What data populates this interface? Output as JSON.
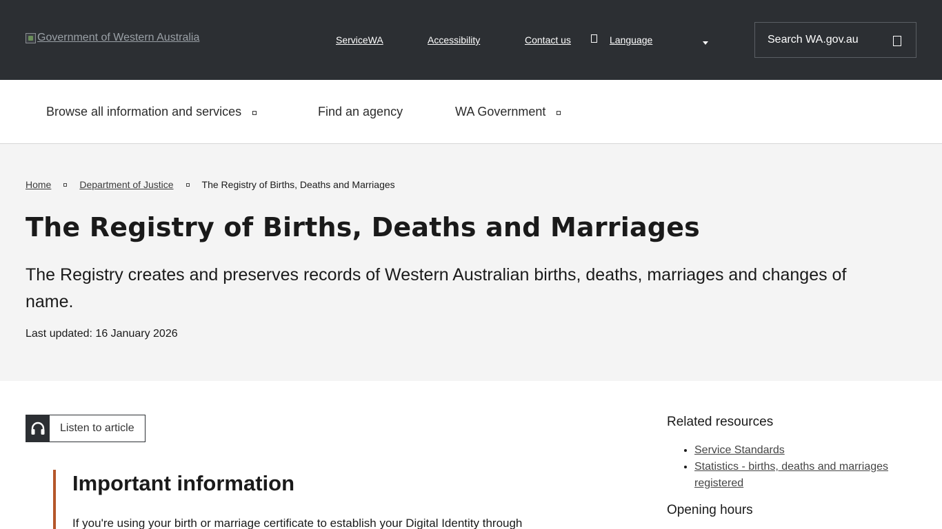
{
  "topbar": {
    "logo_alt": "Government of Western Australia",
    "links": {
      "servicewa": "ServiceWA",
      "accessibility": "Accessibility",
      "contact": "Contact us",
      "language": "Language"
    },
    "search_label": "Search WA.gov.au"
  },
  "nav": {
    "browse": "Browse all information and services",
    "agency": "Find an agency",
    "government": "WA Government"
  },
  "breadcrumb": {
    "home": "Home",
    "department": "Department of Justice",
    "current": "The Registry of Births, Deaths and Marriages"
  },
  "hero": {
    "title": "The Registry of Births, Deaths and Marriages",
    "lead": "The Registry creates and preserves records of Western Australian births, deaths, marriages and changes of name.",
    "updated": "Last updated: 16 January 2026"
  },
  "listen": {
    "label": "Listen to article"
  },
  "important": {
    "heading": "Important information",
    "text": "If you're using your birth or marriage certificate to establish your Digital Identity through"
  },
  "related": {
    "heading": "Related resources",
    "items": [
      "Service Standards",
      "Statistics - births, deaths and marriages registered"
    ],
    "hours_heading": "Opening hours"
  },
  "icons": {
    "headphones": "headphones-icon",
    "search": "search-icon",
    "language": "globe-icon"
  },
  "colors": {
    "topbar": "#2c2f33",
    "hero_bg": "#f4f4f4",
    "accent_border": "#b5562a"
  }
}
